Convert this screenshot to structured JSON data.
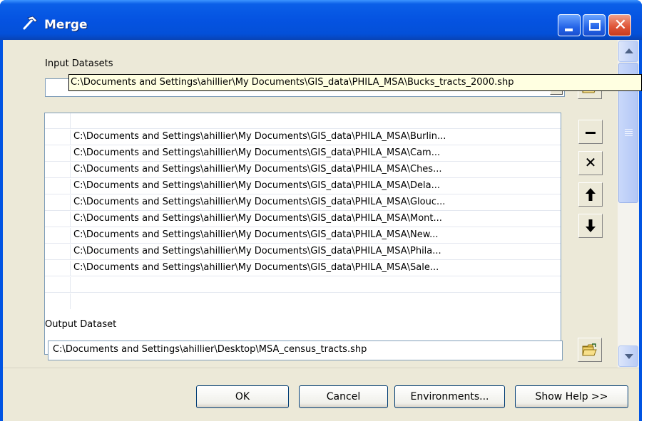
{
  "window": {
    "title": "Merge",
    "buttons": {
      "close_glyph": "✕"
    }
  },
  "form": {
    "input_label": "Input Datasets",
    "input_value": "",
    "list_items": [
      "C:\\Documents and Settings\\ahillier\\My Documents\\GIS_data\\PHILA_MSA\\Burlin...",
      "C:\\Documents and Settings\\ahillier\\My Documents\\GIS_data\\PHILA_MSA\\Cam...",
      "C:\\Documents and Settings\\ahillier\\My Documents\\GIS_data\\PHILA_MSA\\Ches...",
      "C:\\Documents and Settings\\ahillier\\My Documents\\GIS_data\\PHILA_MSA\\Dela...",
      "C:\\Documents and Settings\\ahillier\\My Documents\\GIS_data\\PHILA_MSA\\Glouc...",
      "C:\\Documents and Settings\\ahillier\\My Documents\\GIS_data\\PHILA_MSA\\Mont...",
      "C:\\Documents and Settings\\ahillier\\My Documents\\GIS_data\\PHILA_MSA\\New...",
      "C:\\Documents and Settings\\ahillier\\My Documents\\GIS_data\\PHILA_MSA\\Phila...",
      "C:\\Documents and Settings\\ahillier\\My Documents\\GIS_data\\PHILA_MSA\\Sale..."
    ],
    "tooltip": "C:\\Documents and Settings\\ahillier\\My Documents\\GIS_data\\PHILA_MSA\\Bucks_tracts_2000.shp",
    "side_buttons": {
      "remove": "✕",
      "up": "🡑",
      "down": "🡓"
    },
    "output_label": "Output Dataset",
    "output_value": "C:\\Documents and Settings\\ahillier\\Desktop\\MSA_census_tracts.shp"
  },
  "footer": {
    "ok": "OK",
    "cancel": "Cancel",
    "environments": "Environments...",
    "show_help": "Show Help >>"
  },
  "icons": {
    "title": "hammer-icon",
    "browse": "folder-open-icon",
    "remove": "delete-x-icon",
    "up": "arrow-up-icon",
    "down": "arrow-down-icon"
  },
  "colors": {
    "titlebar": "#0553e1",
    "dialog_bg": "#ece9d8",
    "tooltip_bg": "#ffffe1"
  }
}
